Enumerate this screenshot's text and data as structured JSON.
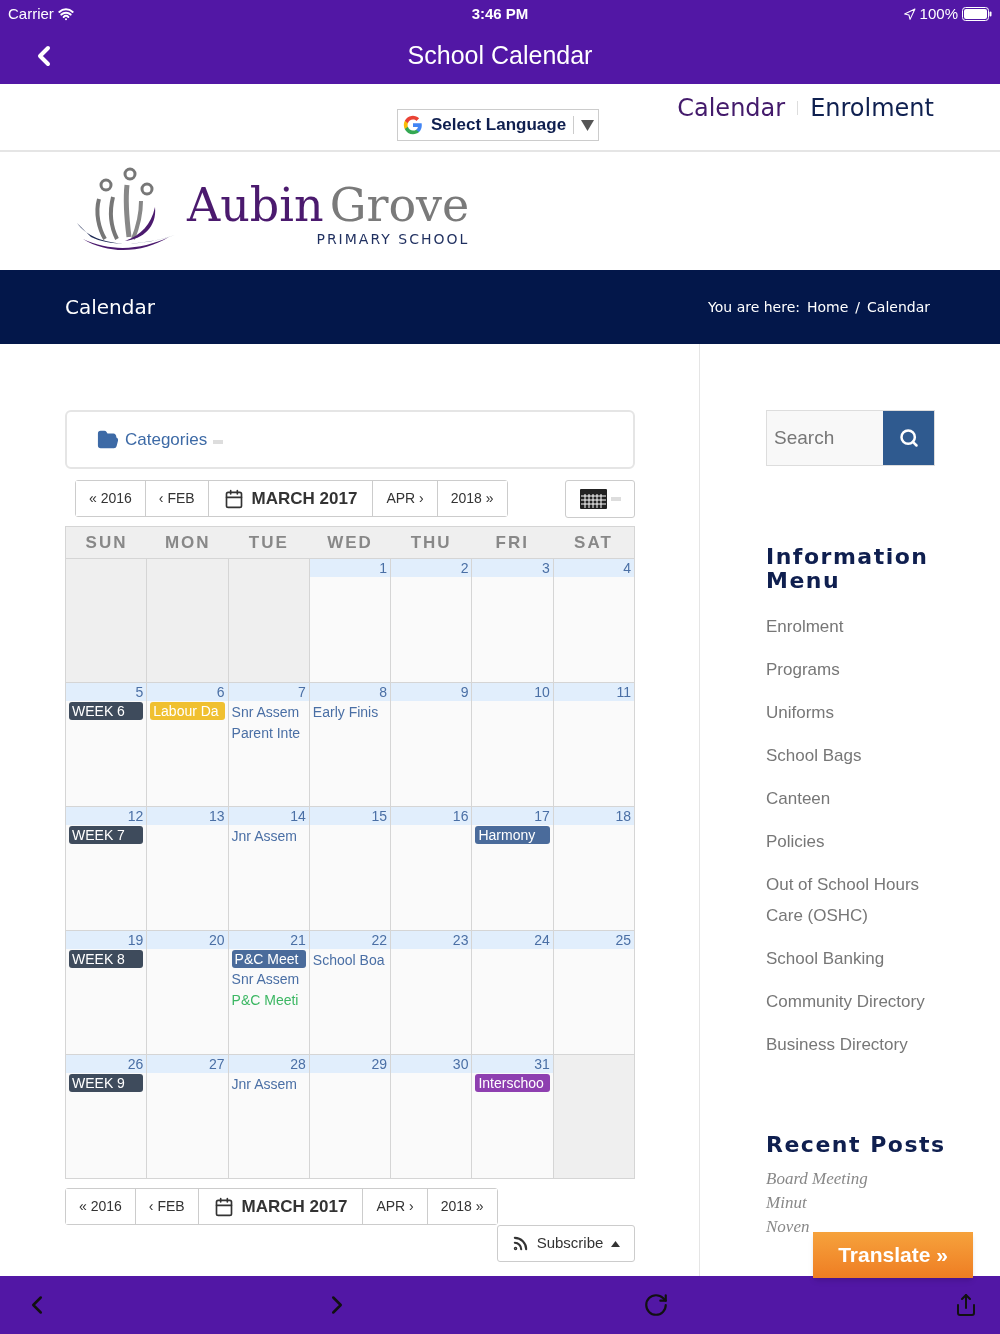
{
  "status_bar": {
    "carrier": "Carrier",
    "time": "3:46 PM",
    "battery": "100%"
  },
  "nav_bar": {
    "title": "School Calendar"
  },
  "header": {
    "language_select": "Select Language",
    "links": [
      "Calendar",
      "Enrolment"
    ]
  },
  "logo": {
    "name_first": "Aubin",
    "name_second": "Grove",
    "subtitle": "PRIMARY SCHOOL"
  },
  "page_banner": {
    "title": "Calendar",
    "breadcrumb_label": "You are here:",
    "breadcrumb": [
      "Home",
      "Calendar"
    ],
    "breadcrumb_separator": "/"
  },
  "categories": {
    "label": "Categories"
  },
  "top_nav": [
    {
      "label": "« 2016",
      "selected": false
    },
    {
      "label": "‹ FEB",
      "selected": false
    },
    {
      "label": "MARCH 2017",
      "selected": true
    },
    {
      "label": "APR ›",
      "selected": false
    },
    {
      "label": "2018 »",
      "selected": false
    }
  ],
  "calendar": {
    "weekdays": [
      "SUN",
      "MON",
      "TUE",
      "WED",
      "THU",
      "FRI",
      "SAT"
    ],
    "weeks": [
      [
        {
          "in_month": false
        },
        {
          "in_month": false
        },
        {
          "in_month": false
        },
        {
          "in_month": true,
          "date": "1"
        },
        {
          "in_month": true,
          "date": "2"
        },
        {
          "in_month": true,
          "date": "3"
        },
        {
          "in_month": true,
          "date": "4"
        }
      ],
      [
        {
          "in_month": true,
          "date": "5",
          "events": [
            {
              "kind": "badge",
              "text": "WEEK 6",
              "color": "#3e4b5c"
            }
          ]
        },
        {
          "in_month": true,
          "date": "6",
          "events": [
            {
              "kind": "badge",
              "text": "Labour Da",
              "color": "#f0c030"
            }
          ]
        },
        {
          "in_month": true,
          "date": "7",
          "events": [
            {
              "kind": "text",
              "text": "Snr Assem",
              "color": "#4a6fa5"
            },
            {
              "kind": "text",
              "text": "Parent Inte",
              "color": "#4a6fa5"
            }
          ]
        },
        {
          "in_month": true,
          "date": "8",
          "events": [
            {
              "kind": "text",
              "text": "Early Finis",
              "color": "#4a6fa5"
            }
          ]
        },
        {
          "in_month": true,
          "date": "9"
        },
        {
          "in_month": true,
          "date": "10"
        },
        {
          "in_month": true,
          "date": "11"
        }
      ],
      [
        {
          "in_month": true,
          "date": "12",
          "events": [
            {
              "kind": "badge",
              "text": "WEEK 7",
              "color": "#3e4b5c"
            }
          ]
        },
        {
          "in_month": true,
          "date": "13"
        },
        {
          "in_month": true,
          "date": "14",
          "events": [
            {
              "kind": "text",
              "text": "Jnr Assem",
              "color": "#4a6fa5"
            }
          ]
        },
        {
          "in_month": true,
          "date": "15"
        },
        {
          "in_month": true,
          "date": "16"
        },
        {
          "in_month": true,
          "date": "17",
          "events": [
            {
              "kind": "badge",
              "text": "Harmony",
              "color": "#4a6b9b"
            }
          ]
        },
        {
          "in_month": true,
          "date": "18"
        }
      ],
      [
        {
          "in_month": true,
          "date": "19",
          "events": [
            {
              "kind": "badge",
              "text": "WEEK 8",
              "color": "#3e4b5c"
            }
          ]
        },
        {
          "in_month": true,
          "date": "20"
        },
        {
          "in_month": true,
          "date": "21",
          "events": [
            {
              "kind": "badge",
              "text": "P&C Meet",
              "color": "#4a6b9b"
            },
            {
              "kind": "text",
              "text": "Snr Assem",
              "color": "#4a6fa5"
            },
            {
              "kind": "text",
              "text": "P&C Meeti",
              "color": "#3cb763"
            }
          ]
        },
        {
          "in_month": true,
          "date": "22",
          "events": [
            {
              "kind": "text",
              "text": "School Boa",
              "color": "#4a6fa5"
            }
          ]
        },
        {
          "in_month": true,
          "date": "23"
        },
        {
          "in_month": true,
          "date": "24"
        },
        {
          "in_month": true,
          "date": "25"
        }
      ],
      [
        {
          "in_month": true,
          "date": "26",
          "events": [
            {
              "kind": "badge",
              "text": "WEEK 9",
              "color": "#3e4b5c"
            }
          ]
        },
        {
          "in_month": true,
          "date": "27"
        },
        {
          "in_month": true,
          "date": "28",
          "events": [
            {
              "kind": "text",
              "text": "Jnr Assem",
              "color": "#4a6fa5"
            }
          ]
        },
        {
          "in_month": true,
          "date": "29"
        },
        {
          "in_month": true,
          "date": "30"
        },
        {
          "in_month": true,
          "date": "31",
          "events": [
            {
              "kind": "badge",
              "text": "Interschoo",
              "color": "#8e3fb0"
            }
          ]
        },
        {
          "in_month": false
        }
      ]
    ]
  },
  "bottom_nav": [
    {
      "label": "« 2016",
      "selected": false
    },
    {
      "label": "‹ FEB",
      "selected": false
    },
    {
      "label": "MARCH 2017",
      "selected": true
    },
    {
      "label": "APR ›",
      "selected": false
    },
    {
      "label": "2018 »",
      "selected": false
    }
  ],
  "subscribe": {
    "label": "Subscribe"
  },
  "sidebar": {
    "search": {
      "placeholder": "Search"
    },
    "menu_title": "Information Menu",
    "menu": [
      "Enrolment",
      "Programs",
      "Uniforms",
      "School Bags",
      "Canteen",
      "Policies",
      "Out of School Hours Care (OSHC)",
      "School Banking",
      "Community Directory",
      "Business Directory"
    ],
    "posts_title": "Recent Posts",
    "posts_lines": [
      "Board Meeting",
      "Minut",
      "Noven"
    ]
  },
  "translate": {
    "label": "Translate »"
  }
}
